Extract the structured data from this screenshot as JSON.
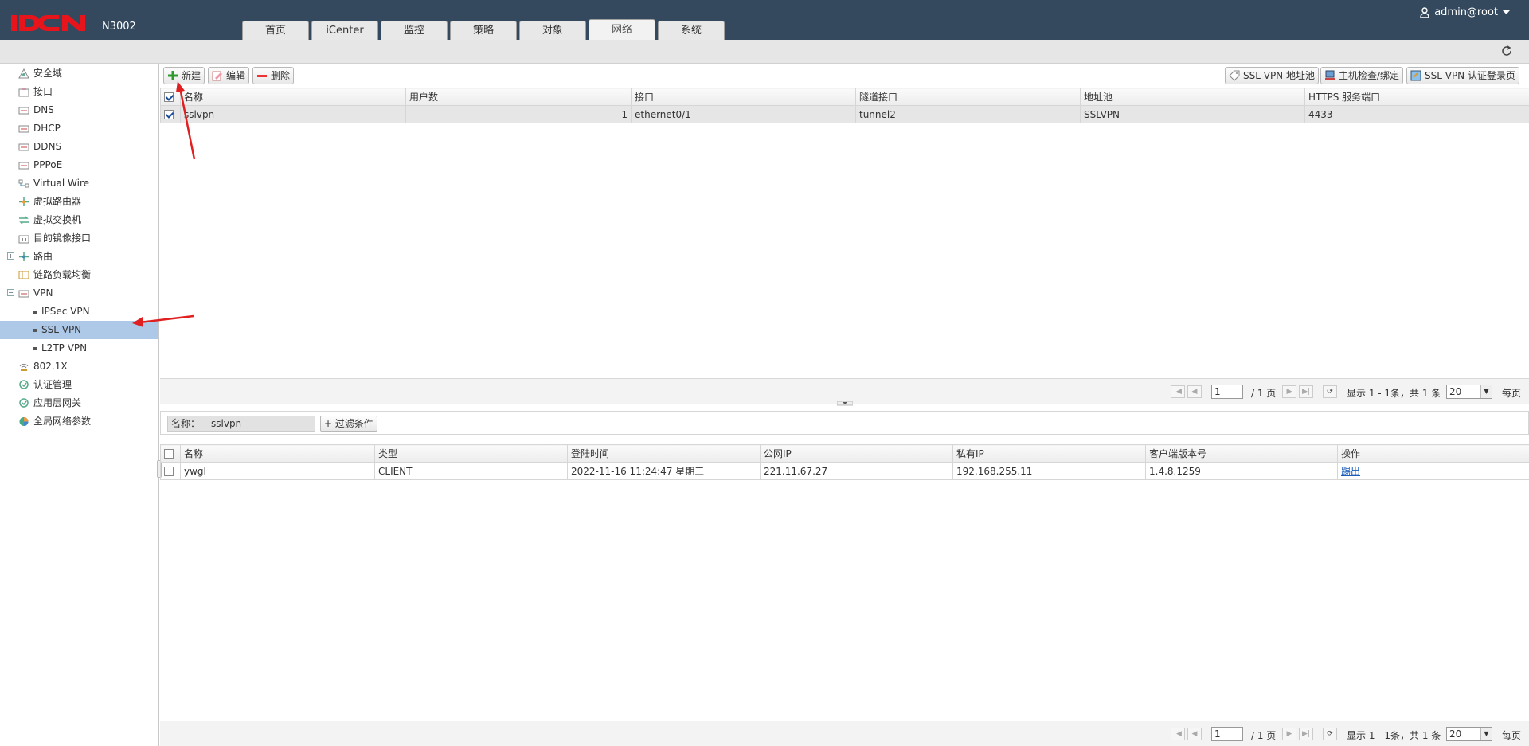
{
  "header": {
    "model": "N3002",
    "tabs": [
      "首页",
      "iCenter",
      "监控",
      "策略",
      "对象",
      "网络",
      "系统"
    ],
    "active_tab": "网络",
    "user": "admin@root",
    "colors": {
      "bar": "#34495e",
      "logo": "#e8141b"
    }
  },
  "sidebar": {
    "items": [
      {
        "label": "安全域",
        "icon": "zone-icon"
      },
      {
        "label": "接口",
        "icon": "interface-icon"
      },
      {
        "label": "DNS",
        "icon": "dns-icon"
      },
      {
        "label": "DHCP",
        "icon": "dhcp-icon"
      },
      {
        "label": "DDNS",
        "icon": "ddns-icon"
      },
      {
        "label": "PPPoE",
        "icon": "pppoe-icon"
      },
      {
        "label": "Virtual Wire",
        "icon": "virtual-wire-icon"
      },
      {
        "label": "虚拟路由器",
        "icon": "virtual-router-icon"
      },
      {
        "label": "虚拟交换机",
        "icon": "virtual-switch-icon"
      },
      {
        "label": "目的镜像接口",
        "icon": "mirror-icon"
      },
      {
        "label": "路由",
        "icon": "routing-icon",
        "expander": "+"
      },
      {
        "label": "链路负载均衡",
        "icon": "load-balance-icon"
      },
      {
        "label": "VPN",
        "icon": "vpn-icon",
        "expander": "−"
      },
      {
        "label": "IPSec VPN",
        "child": true
      },
      {
        "label": "SSL VPN",
        "child": true,
        "selected": true
      },
      {
        "label": "L2TP VPN",
        "child": true
      },
      {
        "label": "802.1X",
        "icon": "dot1x-icon"
      },
      {
        "label": "认证管理",
        "icon": "auth-icon"
      },
      {
        "label": "应用层网关",
        "icon": "alg-icon"
      },
      {
        "label": "全局网络参数",
        "icon": "global-params-icon"
      }
    ]
  },
  "toolbar": {
    "new_label": "新建",
    "edit_label": "编辑",
    "delete_label": "删除",
    "pool_label": "SSL VPN 地址池",
    "host_check_label": "主机检查/绑定",
    "login_page_label": "SSL VPN 认证登录页"
  },
  "top_table": {
    "columns": [
      "名称",
      "用户数",
      "接口",
      "隧道接口",
      "地址池",
      "HTTPS 服务端口"
    ],
    "rows": [
      {
        "name": "sslvpn",
        "users": "1",
        "interface": "ethernet0/1",
        "tunnel": "tunnel2",
        "pool": "SSLVPN",
        "port": "4433"
      }
    ]
  },
  "pager_top": {
    "page": "1",
    "total_pages": "/ 1 页",
    "summary": "显示 1 - 1条，共 1 条",
    "per_page": "20",
    "per_page_label": "每页"
  },
  "filter": {
    "label": "名称：",
    "value": "sslvpn",
    "add_label": "+ 过滤条件"
  },
  "bottom_table": {
    "columns": [
      "名称",
      "类型",
      "登陆时间",
      "公网IP",
      "私有IP",
      "客户端版本号",
      "操作"
    ],
    "rows": [
      {
        "name": "ywgl",
        "type": "CLIENT",
        "login_time": "2022-11-16 11:24:47 星期三",
        "public_ip": "221.11.67.27",
        "private_ip": "192.168.255.11",
        "version": "1.4.8.1259",
        "action": "踢出"
      }
    ]
  },
  "pager_bottom": {
    "page": "1",
    "total_pages": "/ 1 页",
    "summary": "显示 1 - 1条，共 1 条",
    "per_page": "20",
    "per_page_label": "每页"
  }
}
